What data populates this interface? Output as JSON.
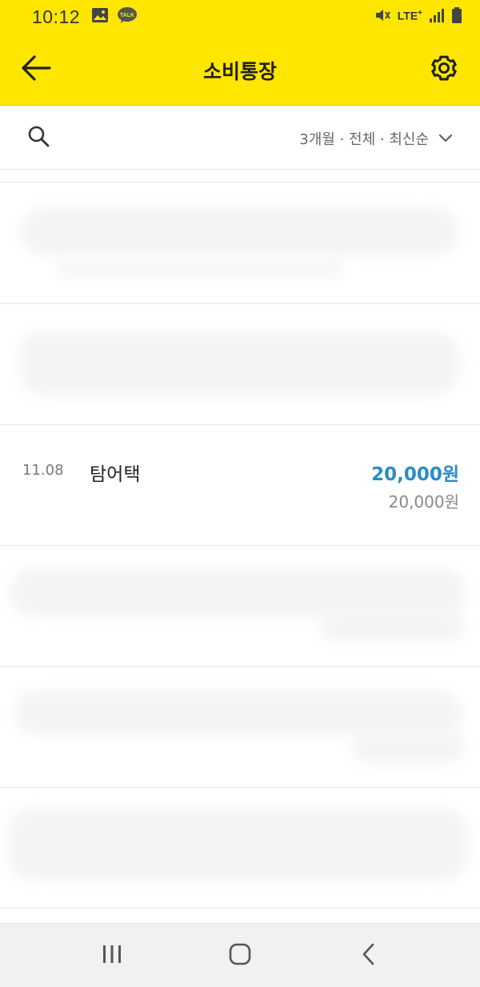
{
  "status_bar": {
    "time": "10:12",
    "left_icons": [
      "gallery-icon",
      "kakaotalk-icon"
    ],
    "lte_label": "LTE",
    "lte_plus": "+",
    "right_icons": [
      "mute-icon",
      "lte-icon",
      "signal-icon",
      "battery-icon"
    ]
  },
  "header": {
    "title": "소비통장",
    "back_icon": "arrow-left-icon",
    "settings_icon": "gear-icon",
    "background_color": "#FFE600"
  },
  "filter": {
    "search_icon": "search-icon",
    "label": "3개월 · 전체 · 최신순",
    "chevron_icon": "chevron-down-icon"
  },
  "transactions": [
    {
      "date": "11.08",
      "merchant": "탐어택",
      "amount": "20,000원",
      "balance": "20,000원"
    }
  ],
  "colors": {
    "amount": "#2a8cc4",
    "accent": "#FFE600"
  },
  "nav_bar": {
    "icons": [
      "recent-apps-icon",
      "home-icon",
      "back-nav-icon"
    ]
  }
}
